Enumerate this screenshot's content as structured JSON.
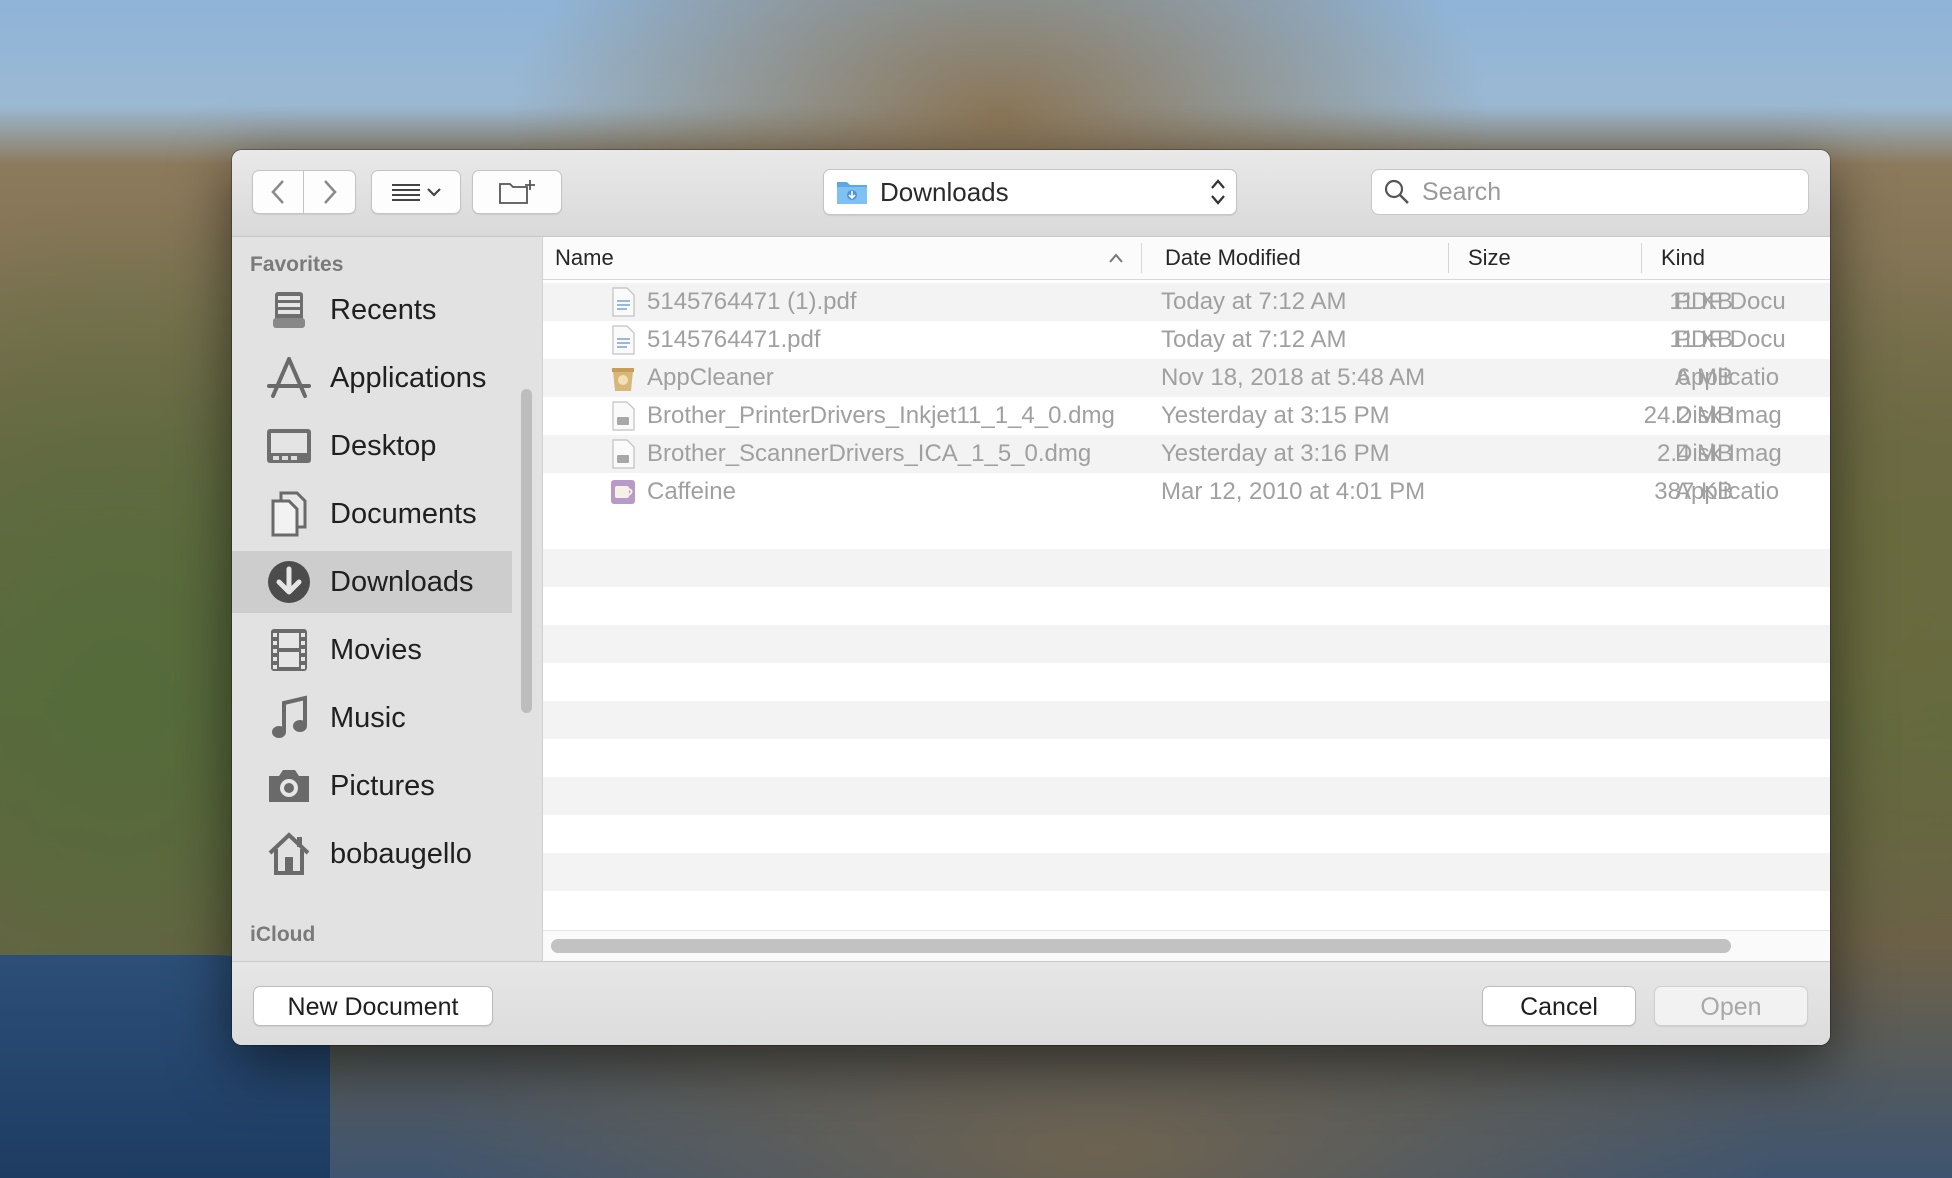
{
  "colors": {
    "selected_sidebar": "#cdcdcd",
    "folder_blue": "#5aa9e6",
    "dimmed_text": "#a0a0a0"
  },
  "toolbar": {
    "back_icon": "chevron-left-icon",
    "forward_icon": "chevron-right-icon",
    "view_icon": "list-view-icon",
    "new_folder_icon": "new-folder-icon",
    "location": "Downloads",
    "search_placeholder": "Search"
  },
  "sidebar": {
    "favorites_header": "Favorites",
    "items": [
      {
        "label": "Recents",
        "icon": "recents-icon"
      },
      {
        "label": "Applications",
        "icon": "applications-icon"
      },
      {
        "label": "Desktop",
        "icon": "desktop-icon"
      },
      {
        "label": "Documents",
        "icon": "documents-icon"
      },
      {
        "label": "Downloads",
        "icon": "downloads-icon",
        "selected": true
      },
      {
        "label": "Movies",
        "icon": "movies-icon"
      },
      {
        "label": "Music",
        "icon": "music-icon"
      },
      {
        "label": "Pictures",
        "icon": "pictures-icon"
      },
      {
        "label": "bobaugello",
        "icon": "home-icon"
      }
    ],
    "icloud_header": "iCloud"
  },
  "columns": [
    "Name",
    "Date Modified",
    "Size",
    "Kind"
  ],
  "files": [
    {
      "name": "5145764471 (1).pdf",
      "date": "Today at 7:12 AM",
      "size": "11 KB",
      "kind": "PDF Docu",
      "icon": "pdf-icon"
    },
    {
      "name": "5145764471.pdf",
      "date": "Today at 7:12 AM",
      "size": "11 KB",
      "kind": "PDF Docu",
      "icon": "pdf-icon"
    },
    {
      "name": "AppCleaner",
      "date": "Nov 18, 2018 at 5:48 AM",
      "size": "6 MB",
      "kind": "Applicatio",
      "icon": "app-icon"
    },
    {
      "name": "Brother_PrinterDrivers_Inkjet11_1_4_0.dmg",
      "date": "Yesterday at 3:15 PM",
      "size": "24.2 MB",
      "kind": "Disk Imag",
      "icon": "disk-image-icon"
    },
    {
      "name": "Brother_ScannerDrivers_ICA_1_5_0.dmg",
      "date": "Yesterday at 3:16 PM",
      "size": "2.4 MB",
      "kind": "Disk Imag",
      "icon": "disk-image-icon"
    },
    {
      "name": "Caffeine",
      "date": "Mar 12, 2010 at 4:01 PM",
      "size": "387 KB",
      "kind": "Applicatio",
      "icon": "app-icon"
    }
  ],
  "buttons": {
    "new_document": "New Document",
    "cancel": "Cancel",
    "open": "Open"
  }
}
